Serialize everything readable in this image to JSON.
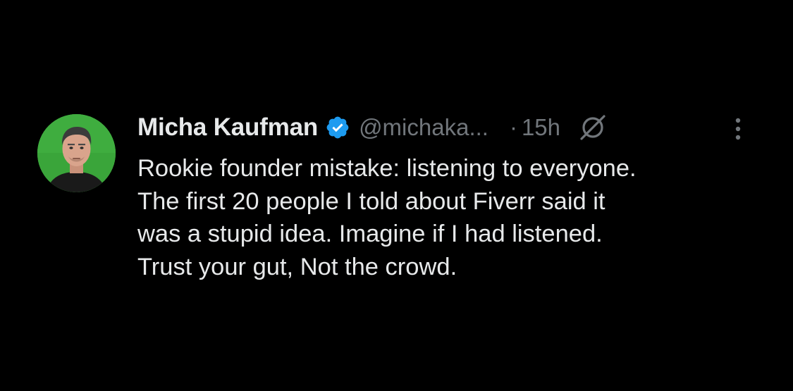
{
  "tweet": {
    "author": {
      "display_name": "Micha Kaufman",
      "handle": "@michaka...",
      "verified": true,
      "avatar_icon": "avatar-photo"
    },
    "separator": "·",
    "timestamp": "15h",
    "icons": {
      "verified": "verified-badge-icon",
      "grok": "grok-icon",
      "more": "more-options-icon"
    },
    "text_lines": [
      "Rookie founder mistake: listening to everyone.",
      "The first 20 people I told about Fiverr said it",
      "was a stupid idea. Imagine if I had listened.",
      "Trust your gut, Not the crowd."
    ]
  },
  "colors": {
    "background": "#000000",
    "primary_text": "#e7e9ea",
    "secondary_text": "#71767b",
    "verified_blue": "#1d9bf0",
    "avatar_green": "#3aa53a"
  }
}
